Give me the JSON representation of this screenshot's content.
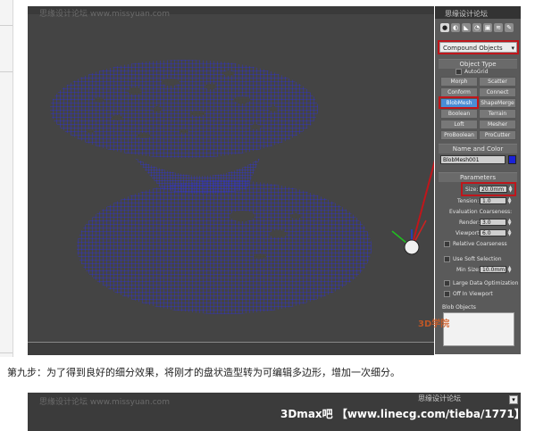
{
  "viewport": {
    "watermark": "思缘设计论坛 www.missyuan.com"
  },
  "panel": {
    "top_text": "思缘设计论坛",
    "tabs": [
      "●",
      "◐",
      "◣",
      "◔",
      "▣",
      "≋",
      "✎"
    ],
    "category_dropdown": "Compound Objects",
    "object_type": {
      "header": "Object Type",
      "autogrid_label": "AutoGrid",
      "buttons": [
        {
          "label": "Morph",
          "active": false
        },
        {
          "label": "Scatter",
          "active": false
        },
        {
          "label": "Conform",
          "active": false
        },
        {
          "label": "Connect",
          "active": false
        },
        {
          "label": "BlobMesh",
          "active": true
        },
        {
          "label": "ShapeMerge",
          "active": false
        },
        {
          "label": "Boolean",
          "active": false
        },
        {
          "label": "Terrain",
          "active": false
        },
        {
          "label": "Loft",
          "active": false
        },
        {
          "label": "Mesher",
          "active": false
        },
        {
          "label": "ProBoolean",
          "active": false
        },
        {
          "label": "ProCutter",
          "active": false
        }
      ]
    },
    "name_and_color": {
      "header": "Name and Color",
      "name_value": "BlobMesh001",
      "swatch_color": "#1a22d8"
    },
    "parameters": {
      "header": "Parameters",
      "size_label": "Size:",
      "size_value": "20.0mm",
      "tension_label": "Tension:",
      "tension_value": "1.0",
      "evaluation_label": "Evaluation Coarseness:",
      "render_label": "Render:",
      "render_value": "3.0",
      "viewport_label": "Viewport:",
      "viewport_value": "6.0",
      "relative_coarseness_label": "Relative Coarseness",
      "use_soft_selection_label": "Use Soft Selection",
      "min_size_label": "Min Size:",
      "min_size_value": "10.0mm",
      "large_data_label": "Large Data Optimization",
      "off_in_viewport_label": "Off In Viewport",
      "blob_objects_header": "Blob Objects"
    }
  },
  "caption": "第九步：为了得到良好的细分效果，将刚才的盘状造型转为可编辑多边形，增加一次细分。",
  "lower_image": {
    "watermark": "思缘设计论坛 www.missyuan.com",
    "top_text": "思缘设计论坛",
    "banner": "3Dmax吧 【www.linecg.com/tieba/1771】"
  },
  "logo": "3D学院",
  "colors": {
    "mesh": "#2b2ee0",
    "highlight": "#c0161b",
    "viewport_bg": "#444444",
    "panel_bg": "#5a5a5a"
  }
}
